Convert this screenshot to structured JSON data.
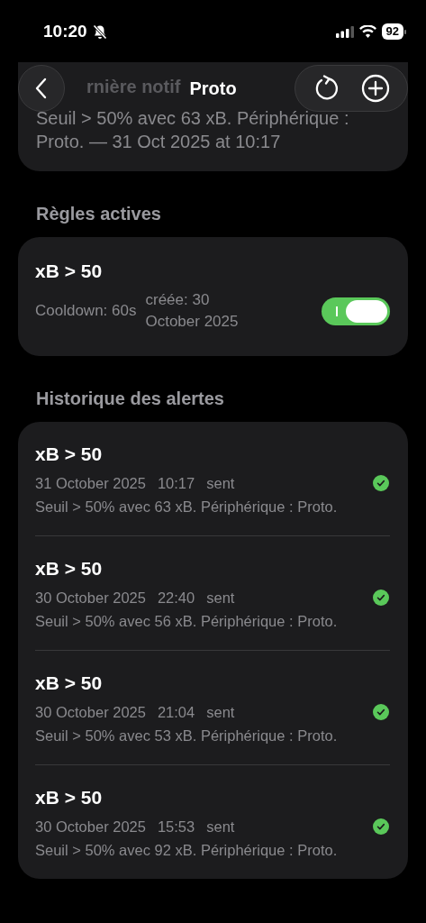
{
  "status_bar": {
    "time": "10:20",
    "battery": "92"
  },
  "nav": {
    "title": "Proto"
  },
  "last_notification": {
    "title": "rnière notif",
    "message": "Seuil > 50% avec 63 xB. Périphérique : Proto. — 31 Oct 2025 at 10:17"
  },
  "rules": {
    "heading": "Règles actives",
    "items": [
      {
        "name": "xB > 50",
        "cooldown": "Cooldown: 60s",
        "created": "créée: 30 October 2025",
        "enabled": true
      }
    ]
  },
  "history": {
    "heading": "Historique des alertes",
    "items": [
      {
        "title": "xB > 50",
        "date": "31 October 2025",
        "time": "10:17",
        "status": "sent",
        "delivered": true,
        "message": "Seuil > 50% avec 63 xB. Périphérique : Proto."
      },
      {
        "title": "xB > 50",
        "date": "30 October 2025",
        "time": "22:40",
        "status": "sent",
        "delivered": true,
        "message": "Seuil > 50% avec 56 xB. Périphérique : Proto."
      },
      {
        "title": "xB > 50",
        "date": "30 October 2025",
        "time": "21:04",
        "status": "sent",
        "delivered": true,
        "message": "Seuil > 50% avec 53 xB. Périphérique : Proto."
      },
      {
        "title": "xB > 50",
        "date": "30 October 2025",
        "time": "15:53",
        "status": "sent",
        "delivered": true,
        "message": "Seuil > 50% avec 92 xB. Périphérique : Proto."
      }
    ]
  }
}
